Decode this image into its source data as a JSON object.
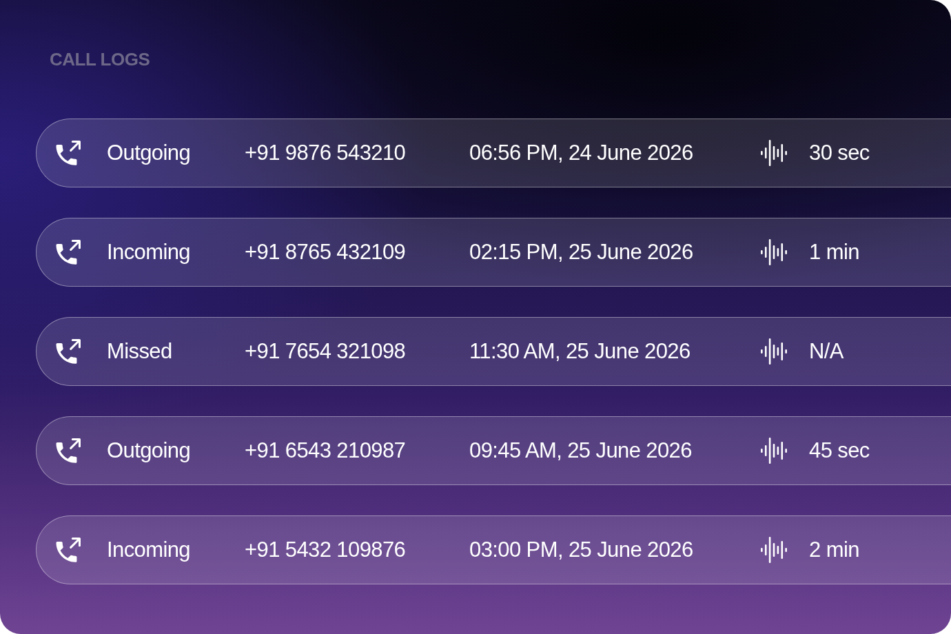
{
  "title": "CALL LOGS",
  "calls": [
    {
      "type": "Outgoing",
      "number": "+91 9876 543210",
      "time": "06:56 PM, 24 June 2026",
      "duration": "30 sec"
    },
    {
      "type": "Incoming",
      "number": "+91 8765 432109",
      "time": "02:15 PM, 25 June 2026",
      "duration": "1 min"
    },
    {
      "type": "Missed",
      "number": "+91 7654 321098",
      "time": "11:30 AM, 25 June 2026",
      "duration": "N/A"
    },
    {
      "type": "Outgoing",
      "number": "+91 6543 210987",
      "time": "09:45 AM, 25 June 2026",
      "duration": "45 sec"
    },
    {
      "type": "Incoming",
      "number": "+91 5432 109876",
      "time": "03:00 PM, 25 June 2026",
      "duration": "2 min"
    }
  ]
}
